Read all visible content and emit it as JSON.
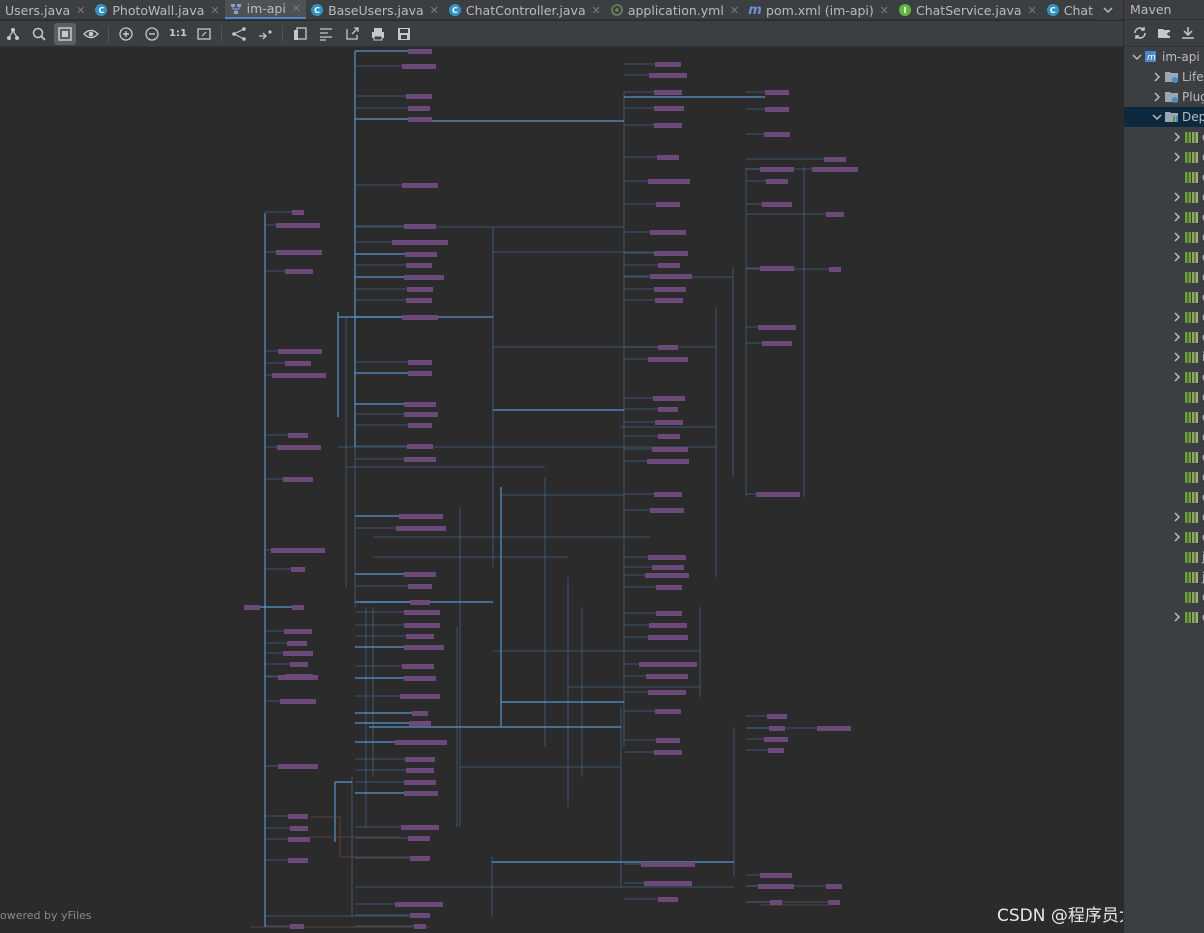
{
  "tabs": [
    {
      "label": "Users.java",
      "icon": "class-icon",
      "color": "#3592c4",
      "closable": true
    },
    {
      "label": "PhotoWall.java",
      "icon": "class-icon",
      "color": "#3592c4",
      "closable": true
    },
    {
      "label": "im-api",
      "icon": "diagram-icon",
      "color": "#8a9fd0",
      "closable": true,
      "active": true
    },
    {
      "label": "BaseUsers.java",
      "icon": "class-icon",
      "color": "#3592c4",
      "closable": true
    },
    {
      "label": "ChatController.java",
      "icon": "class-icon",
      "color": "#3592c4",
      "closable": true
    },
    {
      "label": "application.yml",
      "icon": "spring-config-icon",
      "color": "#6a8759",
      "closable": true
    },
    {
      "label": "pom.xml (im-api)",
      "icon": "maven-icon",
      "color": "#6b8fd1",
      "closable": true
    },
    {
      "label": "ChatService.java",
      "icon": "interface-icon",
      "color": "#62b543",
      "closable": true
    },
    {
      "label": "Chat",
      "icon": "class-icon",
      "color": "#3592c4",
      "closable": false
    }
  ],
  "maven": {
    "title": "Maven",
    "tree": [
      {
        "label": "im-api",
        "icon": "maven-project-icon",
        "depth": 0,
        "state": "expanded"
      },
      {
        "label": "Life",
        "icon": "lifecycle-folder-icon",
        "depth": 1,
        "state": "collapsed"
      },
      {
        "label": "Plug",
        "icon": "plugins-folder-icon",
        "depth": 1,
        "state": "collapsed"
      },
      {
        "label": "Dep",
        "icon": "dependencies-folder-icon",
        "depth": 1,
        "state": "expanded",
        "selected": true
      },
      {
        "label": "o",
        "icon": "library-icon",
        "depth": 2,
        "state": "collapsed"
      },
      {
        "label": "o",
        "icon": "library-icon",
        "depth": 2,
        "state": "collapsed"
      },
      {
        "label": "o",
        "icon": "library-icon",
        "depth": 2,
        "state": "leaf"
      },
      {
        "label": "o",
        "icon": "library-icon",
        "depth": 2,
        "state": "collapsed"
      },
      {
        "label": "o",
        "icon": "library-icon",
        "depth": 2,
        "state": "collapsed"
      },
      {
        "label": "o",
        "icon": "library-icon",
        "depth": 2,
        "state": "collapsed"
      },
      {
        "label": "o",
        "icon": "library-icon",
        "depth": 2,
        "state": "collapsed"
      },
      {
        "label": "o",
        "icon": "library-icon",
        "depth": 2,
        "state": "leaf"
      },
      {
        "label": "o",
        "icon": "library-icon",
        "depth": 2,
        "state": "leaf"
      },
      {
        "label": "o",
        "icon": "library-icon",
        "depth": 2,
        "state": "collapsed"
      },
      {
        "label": "o",
        "icon": "library-icon",
        "depth": 2,
        "state": "collapsed"
      },
      {
        "label": "i",
        "icon": "library-icon",
        "depth": 2,
        "state": "collapsed"
      },
      {
        "label": "o",
        "icon": "library-icon",
        "depth": 2,
        "state": "collapsed"
      },
      {
        "label": "o",
        "icon": "library-icon",
        "depth": 2,
        "state": "leaf"
      },
      {
        "label": "o",
        "icon": "library-icon",
        "depth": 2,
        "state": "leaf"
      },
      {
        "label": "o",
        "icon": "library-icon",
        "depth": 2,
        "state": "leaf"
      },
      {
        "label": "o",
        "icon": "library-icon",
        "depth": 2,
        "state": "leaf"
      },
      {
        "label": "o",
        "icon": "library-icon",
        "depth": 2,
        "state": "leaf"
      },
      {
        "label": "o",
        "icon": "library-icon",
        "depth": 2,
        "state": "leaf"
      },
      {
        "label": "o",
        "icon": "library-icon",
        "depth": 2,
        "state": "collapsed"
      },
      {
        "label": "o",
        "icon": "library-icon",
        "depth": 2,
        "state": "collapsed"
      },
      {
        "label": "j",
        "icon": "library-icon",
        "depth": 2,
        "state": "leaf"
      },
      {
        "label": "j",
        "icon": "library-icon",
        "depth": 2,
        "state": "leaf"
      },
      {
        "label": "o",
        "icon": "library-icon",
        "depth": 2,
        "state": "leaf"
      },
      {
        "label": "o",
        "icon": "library-icon",
        "depth": 2,
        "state": "collapsed"
      }
    ]
  },
  "canvas": {
    "yfiles_label": "owered by yFiles",
    "csdn_watermark": "CSDN @程序员大佬超"
  },
  "colors": {
    "node_fill": "#6b4a7a",
    "edge": "#4c77a8",
    "edge_highlight": "#5b9bd5",
    "edge_alt": "#8a4a4a",
    "selection": "#0d293e"
  }
}
